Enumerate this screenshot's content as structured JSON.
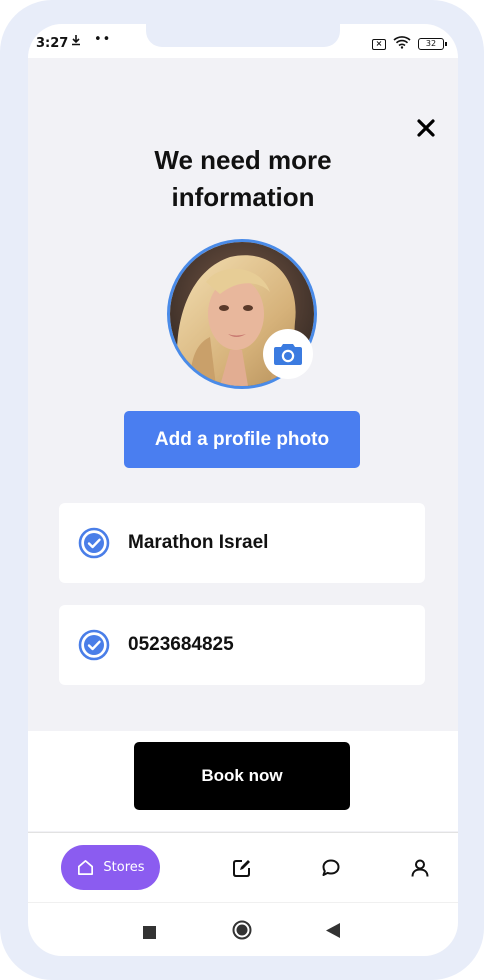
{
  "status_bar": {
    "time": "3:27",
    "download_icon": "download-icon",
    "dots": "••",
    "battery_level": "32"
  },
  "dialog": {
    "title_line1": "We need more",
    "title_line2": "information",
    "close_icon": "close-icon",
    "avatar_description": "profile photo",
    "camera_icon": "camera-icon",
    "add_photo_label": "Add a profile photo",
    "fields": [
      {
        "value": "Marathon Israel",
        "icon": "check-circle-icon"
      },
      {
        "value": "0523684825",
        "icon": "check-circle-icon"
      }
    ]
  },
  "book_button_label": "Book now",
  "bottom_nav": {
    "items": [
      {
        "label": "Stores",
        "icon": "home-icon",
        "active": true
      },
      {
        "icon": "edit-icon"
      },
      {
        "icon": "chat-icon"
      },
      {
        "icon": "user-icon"
      }
    ]
  },
  "colors": {
    "accent_blue": "#4a7ef0",
    "nav_active": "#8b5cf0",
    "check_blue": "#4a8be8"
  }
}
